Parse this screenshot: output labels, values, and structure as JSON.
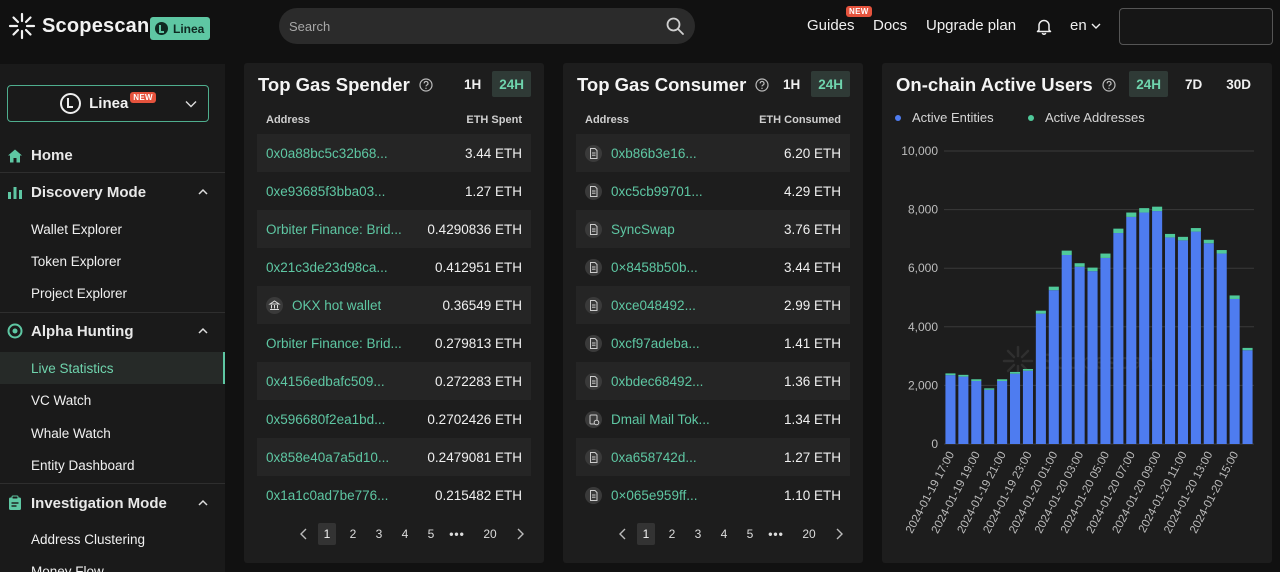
{
  "header": {
    "brand": "Scopescan",
    "chain_badge": "Linea",
    "search_placeholder": "Search",
    "nav": [
      {
        "label": "Guides",
        "badge": "NEW"
      },
      {
        "label": "Docs"
      },
      {
        "label": "Upgrade plan"
      }
    ],
    "language": "en"
  },
  "sidebar": {
    "chain_select": {
      "name": "Linea",
      "badge": "NEW"
    },
    "home": "Home",
    "sections": [
      {
        "label": "Discovery Mode",
        "icon": "bar-chart-icon",
        "items": [
          "Wallet Explorer",
          "Token Explorer",
          "Project Explorer"
        ]
      },
      {
        "label": "Alpha Hunting",
        "icon": "target-icon",
        "items": [
          "Live Statistics",
          "VC Watch",
          "Whale Watch",
          "Entity Dashboard"
        ]
      },
      {
        "label": "Investigation Mode",
        "icon": "clipboard-icon",
        "items": [
          "Address Clustering",
          "Money Flow"
        ]
      }
    ],
    "active_item": "Live Statistics"
  },
  "gas_spender": {
    "title": "Top Gas Spender",
    "timeframes": [
      "1H",
      "24H"
    ],
    "active_timeframe": "24H",
    "col_address": "Address",
    "col_value": "ETH Spent",
    "rows": [
      {
        "address": "0x0a88bc5c32b68...",
        "value": "3.44 ETH",
        "icon": ""
      },
      {
        "address": "0xe93685f3bba03...",
        "value": "1.27 ETH",
        "icon": ""
      },
      {
        "address": "Orbiter Finance: Brid...",
        "value": "0.4290836 ETH",
        "icon": ""
      },
      {
        "address": "0x21c3de23d98ca...",
        "value": "0.412951 ETH",
        "icon": ""
      },
      {
        "address": "OKX hot wallet",
        "value": "0.36549 ETH",
        "icon": "bank-icon"
      },
      {
        "address": "Orbiter Finance: Brid...",
        "value": "0.279813 ETH",
        "icon": ""
      },
      {
        "address": "0x4156edbafc509...",
        "value": "0.272283 ETH",
        "icon": ""
      },
      {
        "address": "0x596680f2ea1bd...",
        "value": "0.2702426 ETH",
        "icon": ""
      },
      {
        "address": "0x858e40a7a5d10...",
        "value": "0.2479081 ETH",
        "icon": ""
      },
      {
        "address": "0x1a1c0ad7be776...",
        "value": "0.215482 ETH",
        "icon": ""
      }
    ],
    "pager": {
      "pages": [
        "1",
        "2",
        "3",
        "4",
        "5"
      ],
      "ellipsis": "•••",
      "last": "20",
      "active": "1"
    }
  },
  "gas_consumer": {
    "title": "Top Gas Consumer",
    "timeframes": [
      "1H",
      "24H"
    ],
    "active_timeframe": "24H",
    "col_address": "Address",
    "col_value": "ETH Consumed",
    "rows": [
      {
        "address": "0xb86b3e16...",
        "value": "6.20 ETH",
        "icon": "contract-icon"
      },
      {
        "address": "0xc5cb99701...",
        "value": "4.29 ETH",
        "icon": "contract-icon"
      },
      {
        "address": "SyncSwap",
        "value": "3.76 ETH",
        "icon": "contract-icon"
      },
      {
        "address": "0×8458b50b...",
        "value": "3.44 ETH",
        "icon": "contract-icon"
      },
      {
        "address": "0xce048492...",
        "value": "2.99 ETH",
        "icon": "contract-icon"
      },
      {
        "address": "0xcf97adeba...",
        "value": "1.41 ETH",
        "icon": "contract-icon"
      },
      {
        "address": "0xbdec68492...",
        "value": "1.36 ETH",
        "icon": "contract-icon"
      },
      {
        "address": "Dmail Mail Tok...",
        "value": "1.34 ETH",
        "icon": "token-contract-icon"
      },
      {
        "address": "0xa658742d...",
        "value": "1.27 ETH",
        "icon": "contract-icon"
      },
      {
        "address": "0×065e959ff...",
        "value": "1.10 ETH",
        "icon": "contract-icon"
      }
    ],
    "pager": {
      "pages": [
        "1",
        "2",
        "3",
        "4",
        "5"
      ],
      "ellipsis": "•••",
      "last": "20",
      "active": "1"
    }
  },
  "active_users": {
    "title": "On-chain Active Users",
    "timeframes": [
      "24H",
      "7D",
      "30D"
    ],
    "active_timeframe": "24H",
    "watermark": "Scopescan"
  },
  "colors": {
    "accent": "#5ec7a3",
    "entities": "#4e7cf0",
    "addresses": "#4fc99a",
    "new_badge": "#e5533d"
  },
  "chart_data": {
    "type": "bar",
    "stacked": true,
    "categories": [
      "2024-01-19 17:00",
      "2024-01-19 18:00",
      "2024-01-19 19:00",
      "2024-01-19 20:00",
      "2024-01-19 21:00",
      "2024-01-19 22:00",
      "2024-01-19 23:00",
      "2024-01-20 00:00",
      "2024-01-20 01:00",
      "2024-01-20 02:00",
      "2024-01-20 03:00",
      "2024-01-20 04:00",
      "2024-01-20 05:00",
      "2024-01-20 06:00",
      "2024-01-20 07:00",
      "2024-01-20 08:00",
      "2024-01-20 09:00",
      "2024-01-20 10:00",
      "2024-01-20 11:00",
      "2024-01-20 12:00",
      "2024-01-20 13:00",
      "2024-01-20 14:00",
      "2024-01-20 15:00",
      "2024-01-20 16:00"
    ],
    "tick_labels": [
      "2024-01-19 17:00",
      "2024-01-19 19:00",
      "2024-01-19 21:00",
      "2024-01-19 23:00",
      "2024-01-20 01:00",
      "2024-01-20 03:00",
      "2024-01-20 05:00",
      "2024-01-20 07:00",
      "2024-01-20 09:00",
      "2024-01-20 11:00",
      "2024-01-20 13:00",
      "2024-01-20 15:00"
    ],
    "series": [
      {
        "name": "Active Entities",
        "values": [
          2350,
          2300,
          2150,
          1850,
          2150,
          2400,
          2500,
          4450,
          5250,
          6450,
          6050,
          5900,
          6350,
          7200,
          7750,
          7900,
          7950,
          7050,
          6950,
          7250,
          6850,
          6500,
          4950,
          3200
        ]
      },
      {
        "name": "Active Addresses",
        "values": [
          60,
          60,
          60,
          50,
          60,
          60,
          60,
          100,
          120,
          150,
          120,
          120,
          150,
          150,
          150,
          150,
          150,
          120,
          120,
          120,
          120,
          120,
          120,
          80
        ]
      }
    ],
    "yticks": [
      "0",
      "2,000",
      "4,000",
      "6,000",
      "8,000",
      "10,000"
    ],
    "ylim": [
      0,
      10000
    ],
    "grid": true,
    "legend_position": "top-left"
  }
}
